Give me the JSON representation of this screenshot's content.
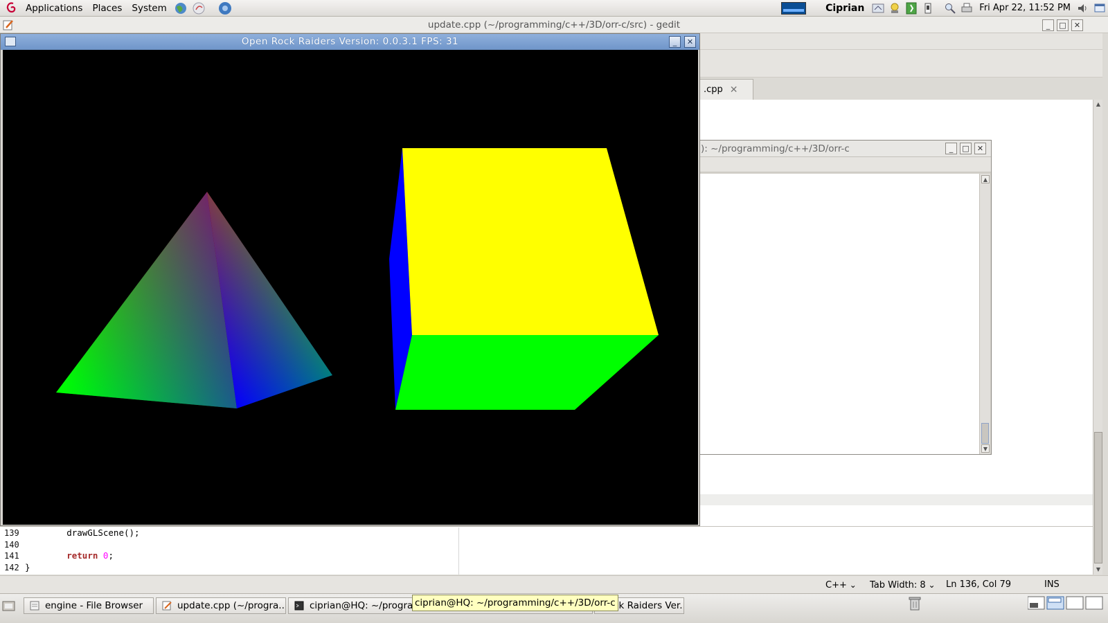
{
  "top_panel": {
    "menus": [
      "Applications",
      "Places",
      "System"
    ],
    "user": "Ciprian",
    "clock": "Fri Apr 22, 11:52 PM"
  },
  "gedit": {
    "title": "update.cpp (~/programming/c++/3D/orr-c/src) - gedit",
    "tab_label": ".cpp",
    "lines": [
      {
        "num": "139",
        "text": "        drawGLScene();"
      },
      {
        "num": "140",
        "text": ""
      },
      {
        "num": "141",
        "text": "        return 0;"
      },
      {
        "num": "142",
        "text": "}"
      }
    ],
    "status": {
      "language": "C++",
      "tab_width": "Tab Width:  8",
      "position": "Ln 136, Col 79",
      "mode": "INS"
    }
  },
  "terminal": {
    "title": "): ~/programming/c++/3D/orr-c"
  },
  "gl_window": {
    "title": "Open Rock Raiders Version: 0.0.3.1 FPS: 31",
    "pyramid_colors": {
      "apex": "#ff0000",
      "left": "#00ff00",
      "right": "#0000ff",
      "back": "#00ff00"
    },
    "cube_colors": {
      "top": "#ffff00",
      "front": "#00ff00",
      "left": "#0000ff"
    }
  },
  "taskbar": {
    "tasks": [
      {
        "label": "engine - File Browser"
      },
      {
        "label": "update.cpp (~/progra..."
      },
      {
        "label": "ciprian@HQ: ~/progra..."
      },
      {
        "label": "Rock Raiders Ver..."
      }
    ],
    "tooltip": "ciprian@HQ: ~/programming/c++/3D/orr-c"
  }
}
